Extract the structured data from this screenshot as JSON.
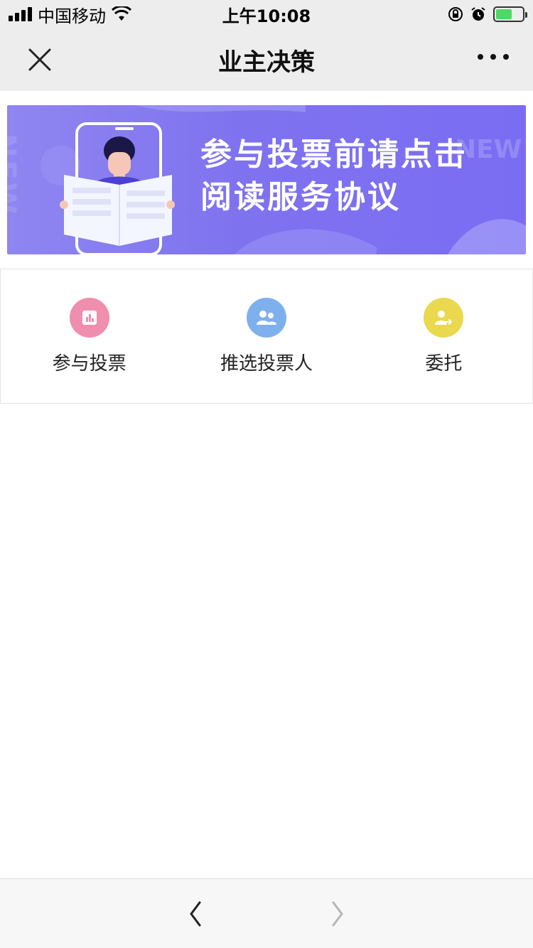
{
  "status_bar": {
    "carrier": "中国移动",
    "time": "上午10:08"
  },
  "nav": {
    "title": "业主决策"
  },
  "banner": {
    "line1": "参与投票前请点击",
    "line2": "阅读服务协议",
    "decor_text": "NEW"
  },
  "menu": {
    "items": [
      {
        "label": "参与投票",
        "icon": "bar-chart-icon",
        "color": "#f08eae"
      },
      {
        "label": "推选投票人",
        "icon": "users-icon",
        "color": "#7fb0ee"
      },
      {
        "label": "委托",
        "icon": "user-share-icon",
        "color": "#ead84f"
      }
    ]
  },
  "colors": {
    "header_bg": "#ededed",
    "banner_start": "#8f86f1",
    "banner_end": "#7b6df3"
  }
}
